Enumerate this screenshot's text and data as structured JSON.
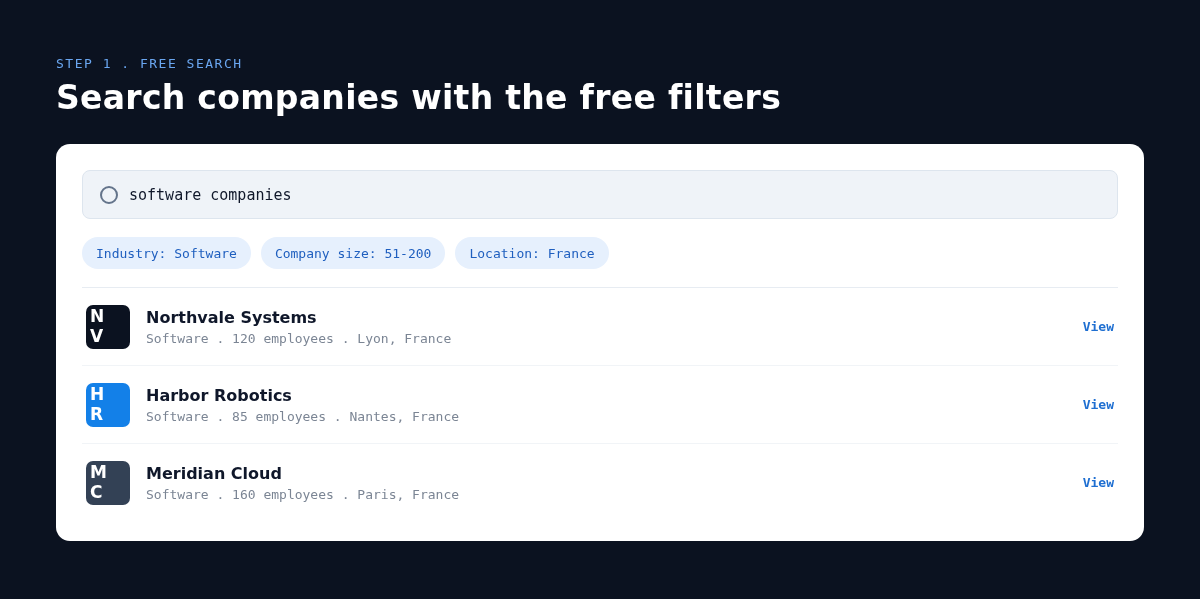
{
  "eyebrow": "STEP 1 . FREE SEARCH",
  "title": "Search companies with the free filters",
  "search": {
    "value": "software companies"
  },
  "filters": [
    {
      "label": "Industry: Software"
    },
    {
      "label": "Company size: 51-200"
    },
    {
      "label": "Location: France"
    }
  ],
  "results": [
    {
      "initials": "NV",
      "color": "#0b1220",
      "name": "Northvale Systems",
      "meta": "Software . 120 employees . Lyon, France",
      "action": "View"
    },
    {
      "initials": "HR",
      "color": "#1380e8",
      "name": "Harbor Robotics",
      "meta": "Software . 85 employees . Nantes, France",
      "action": "View"
    },
    {
      "initials": "MC",
      "color": "#334155",
      "name": "Meridian Cloud",
      "meta": "Software . 160 employees . Paris, France",
      "action": "View"
    }
  ]
}
